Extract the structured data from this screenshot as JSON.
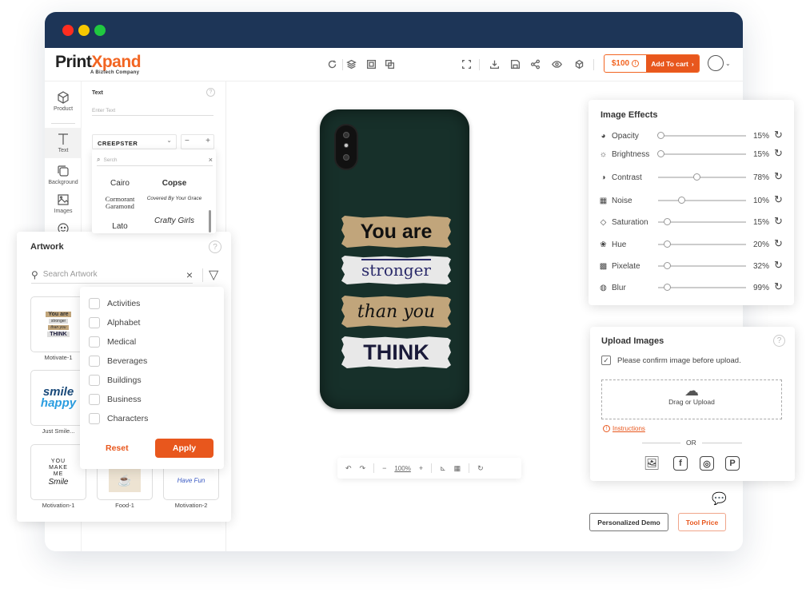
{
  "window": {
    "traffic_lights": [
      "#ff2d20",
      "#f7c800",
      "#20c840"
    ]
  },
  "header": {
    "logo_main": "Print",
    "logo_x": "X",
    "logo_rest": "pand",
    "logo_sub": "A Biztech Company",
    "tools_left": [
      "history-icon",
      "layers-icon",
      "crop-select-icon",
      "duplicate-icon"
    ],
    "tools_right": [
      "fullscreen-icon",
      "download-icon",
      "save-icon",
      "share-icon",
      "preview-icon",
      "3d-view-icon"
    ],
    "price": "$100",
    "add_to_cart": "Add To cart",
    "accent": "#e8571d"
  },
  "sidebar": {
    "items": [
      {
        "label": "Product",
        "icon": "cube-icon"
      },
      {
        "label": "Text",
        "icon": "text-icon",
        "active": true
      },
      {
        "label": "Background",
        "icon": "background-icon"
      },
      {
        "label": "Images",
        "icon": "image-icon"
      },
      {
        "label": "Clipart",
        "icon": "smiley-icon"
      }
    ]
  },
  "text_panel": {
    "title": "Text",
    "input_placeholder": "Enter Text",
    "font_selected": "CREEPSTER",
    "size_minus": "−",
    "size_plus": "+",
    "font_search_placeholder": "Serch",
    "fonts": [
      "Cairo",
      "Copse",
      "Cormorant Garamond",
      "Covered By Your Grace",
      "Lato",
      "Crafty Girls"
    ]
  },
  "canvas": {
    "design_lines": [
      "You are",
      "stronger",
      "than you",
      "THINK"
    ],
    "phone_color": "#17302a",
    "zoom_level": "100%"
  },
  "image_effects": {
    "title": "Image Effects",
    "rows": [
      {
        "label": "Opacity",
        "value": 15,
        "display": "15%",
        "thumb": 0.03,
        "icon": "opacity-icon"
      },
      {
        "label": "Brightness",
        "value": 15,
        "display": "15%",
        "thumb": 0.03,
        "icon": "brightness-icon"
      },
      {
        "label": "Contrast",
        "value": 78,
        "display": "78%",
        "thumb": 0.44,
        "icon": "contrast-icon"
      },
      {
        "label": "Noise",
        "value": 10,
        "display": "10%",
        "thumb": 0.27,
        "icon": "noise-icon"
      },
      {
        "label": "Saturation",
        "value": 15,
        "display": "15%",
        "thumb": 0.1,
        "icon": "saturation-icon"
      },
      {
        "label": "Hue",
        "value": 20,
        "display": "20%",
        "thumb": 0.1,
        "icon": "hue-icon"
      },
      {
        "label": "Pixelate",
        "value": 32,
        "display": "32%",
        "thumb": 0.1,
        "icon": "pixelate-icon"
      },
      {
        "label": "Blur",
        "value": 99,
        "display": "99%",
        "thumb": 0.1,
        "icon": "blur-icon"
      }
    ]
  },
  "upload": {
    "title": "Upload Images",
    "confirm_label": "Please confirm image before upload.",
    "confirm_checked": true,
    "drop_label": "Drag or Upload",
    "instructions": "Instructions",
    "or": "OR",
    "sources": [
      "gallery-icon",
      "facebook-icon",
      "instagram-icon",
      "pinterest-icon"
    ]
  },
  "footer": {
    "demo": "Personalized Demo",
    "price": "Tool Price"
  },
  "artwork": {
    "title": "Artwork",
    "search_placeholder": "Search Artwork",
    "items": [
      "Motivate-1",
      "Just Smile...",
      "Motivation-1",
      "Food-1",
      "Motivation-2"
    ]
  },
  "filter": {
    "categories": [
      "Activities",
      "Alphabet",
      "Medical",
      "Beverages",
      "Buildings",
      "Business",
      "Characters"
    ],
    "reset": "Reset",
    "apply": "Apply"
  }
}
